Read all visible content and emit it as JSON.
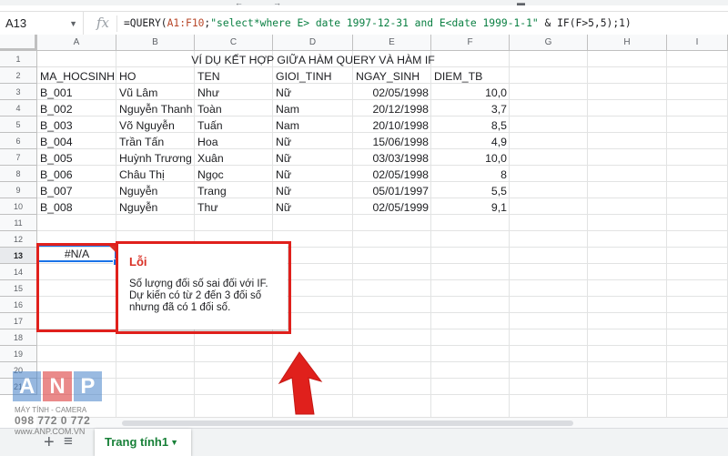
{
  "formula_bar": {
    "name_box": "A13",
    "fx": "fx",
    "formula_prefix": "=QUERY(",
    "formula_range": "A1:F10",
    "formula_mid": ";",
    "formula_string": "\"select*where E> date 1997-12-31 and E<date 1999-1-1\"",
    "formula_rest": " & IF(F>5,5);1)"
  },
  "columns": [
    "A",
    "B",
    "C",
    "D",
    "E",
    "F",
    "G",
    "H",
    "I"
  ],
  "rows": [
    "1",
    "2",
    "3",
    "4",
    "5",
    "6",
    "7",
    "8",
    "9",
    "10",
    "11",
    "12",
    "13",
    "14",
    "15",
    "16",
    "17",
    "18",
    "19",
    "20",
    "21"
  ],
  "sheet": {
    "title": "VÍ DỤ KẾT HỢP GIỮA HÀM QUERY VÀ HÀM IF",
    "headers": [
      "MA_HOCSINH",
      "HO",
      "TEN",
      "GIOI_TINH",
      "NGAY_SINH",
      "DIEM_TB"
    ],
    "data": [
      [
        "B_001",
        "Vũ Lâm",
        "Như",
        "Nữ",
        "02/05/1998",
        "10,0"
      ],
      [
        "B_002",
        "Nguyễn Thanh",
        "Toàn",
        "Nam",
        "20/12/1998",
        "3,7"
      ],
      [
        "B_003",
        "Võ Nguyễn",
        "Tuấn",
        "Nam",
        "20/10/1998",
        "8,5"
      ],
      [
        "B_004",
        "Trần Tấn",
        "Hoa",
        "Nữ",
        "15/06/1998",
        "4,9"
      ],
      [
        "B_005",
        "Huỳnh Trương",
        "Xuân",
        "Nữ",
        "03/03/1998",
        "10,0"
      ],
      [
        "B_006",
        "Châu Thị",
        "Ngọc",
        "Nữ",
        "02/05/1998",
        "8"
      ],
      [
        "B_007",
        "Nguyễn",
        "Trang",
        "Nữ",
        "05/01/1997",
        "5,5"
      ],
      [
        "B_008",
        "Nguyễn",
        "Thư",
        "Nữ",
        "02/05/1999",
        "9,1"
      ]
    ],
    "a13_value": "#N/A"
  },
  "error_popup": {
    "title": "Lỗi",
    "message": "Số lượng đối số sai đối với IF. Dự kiến có từ 2 đến 3 đối số nhưng đã có 1 đối số."
  },
  "tabs": {
    "add_icon": "+",
    "list_icon": "≡",
    "active_tab": "Trang tính1",
    "dropdown_icon": "▼"
  },
  "watermark": {
    "letters": [
      "A",
      "N",
      "P"
    ],
    "line1": "MÁY TÍNH - CAMERA",
    "line2": "098 772 0 772",
    "line3": "www.ANP.COM.VN"
  },
  "colors": {
    "accent_blue": "#1a73e8",
    "error_red": "#d93025",
    "annotation_red": "#e0201c",
    "tab_green": "#188038"
  }
}
